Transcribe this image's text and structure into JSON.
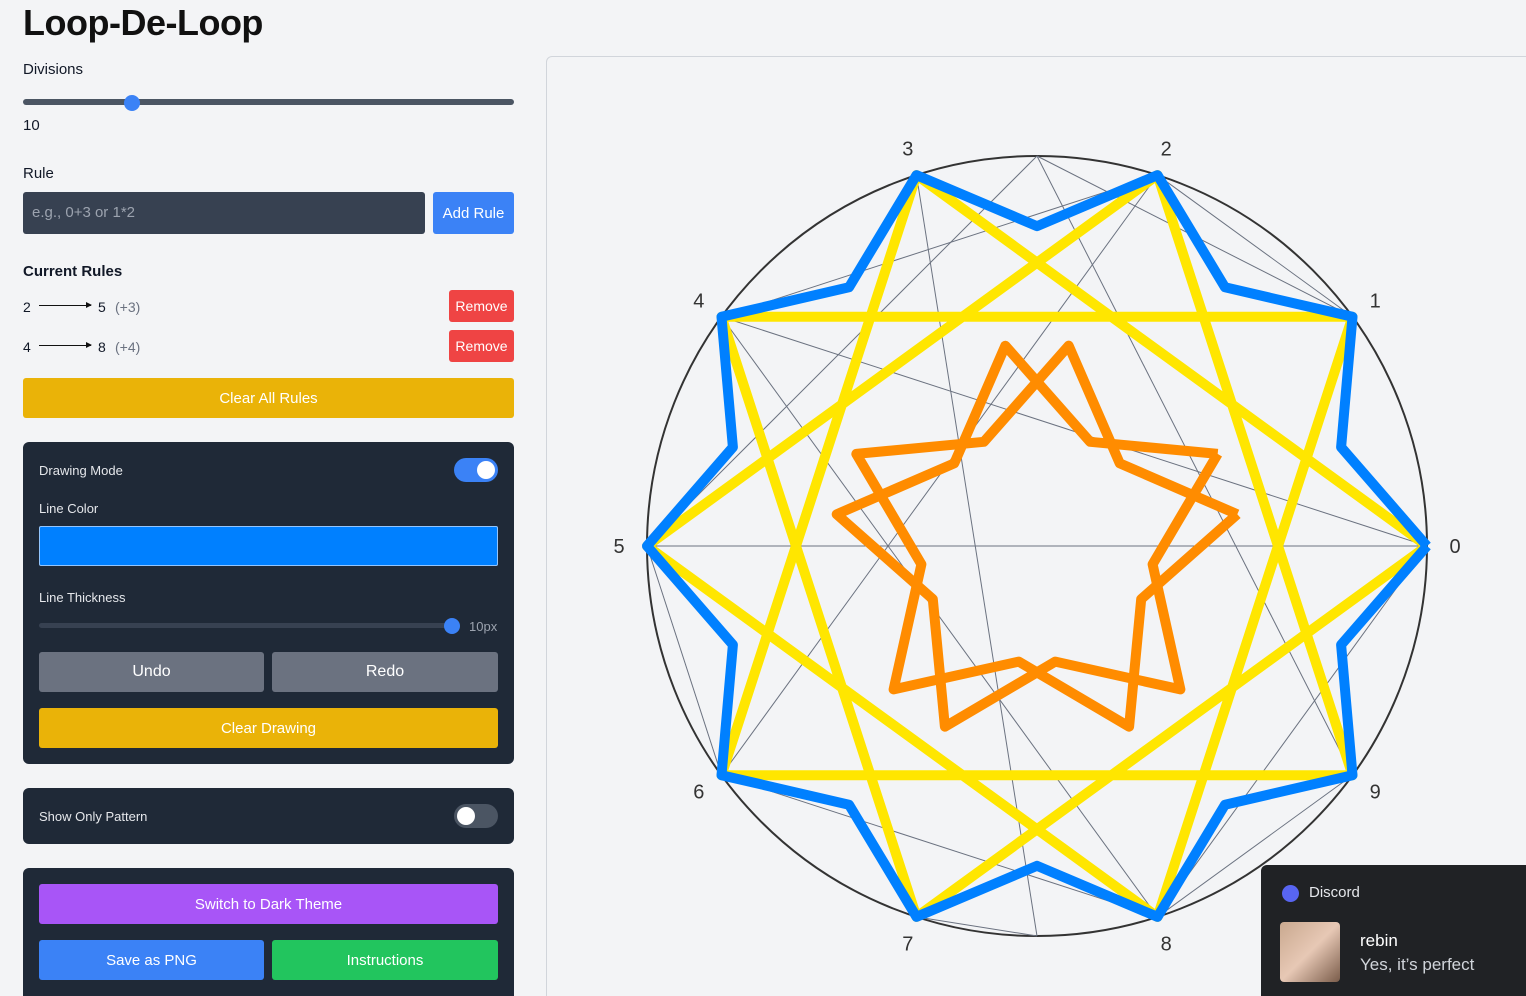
{
  "app": {
    "title": "Loop-De-Loop"
  },
  "divisions": {
    "label": "Divisions",
    "value": "10",
    "min": 2,
    "max": 50,
    "current": 10
  },
  "rule": {
    "label": "Rule",
    "placeholder": "e.g., 0+3 or 1*2",
    "add_label": "Add Rule"
  },
  "rules": {
    "heading": "Current Rules",
    "items": [
      {
        "from": "2",
        "to": "5",
        "delta": "(+3)",
        "remove": "Remove"
      },
      {
        "from": "4",
        "to": "8",
        "delta": "(+4)",
        "remove": "Remove"
      }
    ],
    "clear_label": "Clear All Rules"
  },
  "drawing": {
    "mode_label": "Drawing Mode",
    "mode_on": true,
    "color_label": "Line Color",
    "color": "#0080ff",
    "thickness_label": "Line Thickness",
    "thickness_value": "10px",
    "thickness_fraction": 1.0,
    "undo_label": "Undo",
    "redo_label": "Redo",
    "clear_label": "Clear Drawing"
  },
  "pattern": {
    "label": "Show Only Pattern",
    "on": false
  },
  "actions": {
    "theme_label": "Switch to Dark Theme",
    "save_label": "Save as PNG",
    "instructions_label": "Instructions"
  },
  "circle": {
    "divisions": 10,
    "point_labels": [
      "0",
      "1",
      "2",
      "3",
      "4",
      "5",
      "6",
      "7",
      "8",
      "9"
    ],
    "colors": {
      "blue": "#0080ff",
      "yellow": "#ffe600",
      "orange": "#ff8c00",
      "chord": "#6b7280"
    }
  },
  "notification": {
    "app": "Discord",
    "user": "rebin",
    "message": "Yes, it’s perfect"
  }
}
